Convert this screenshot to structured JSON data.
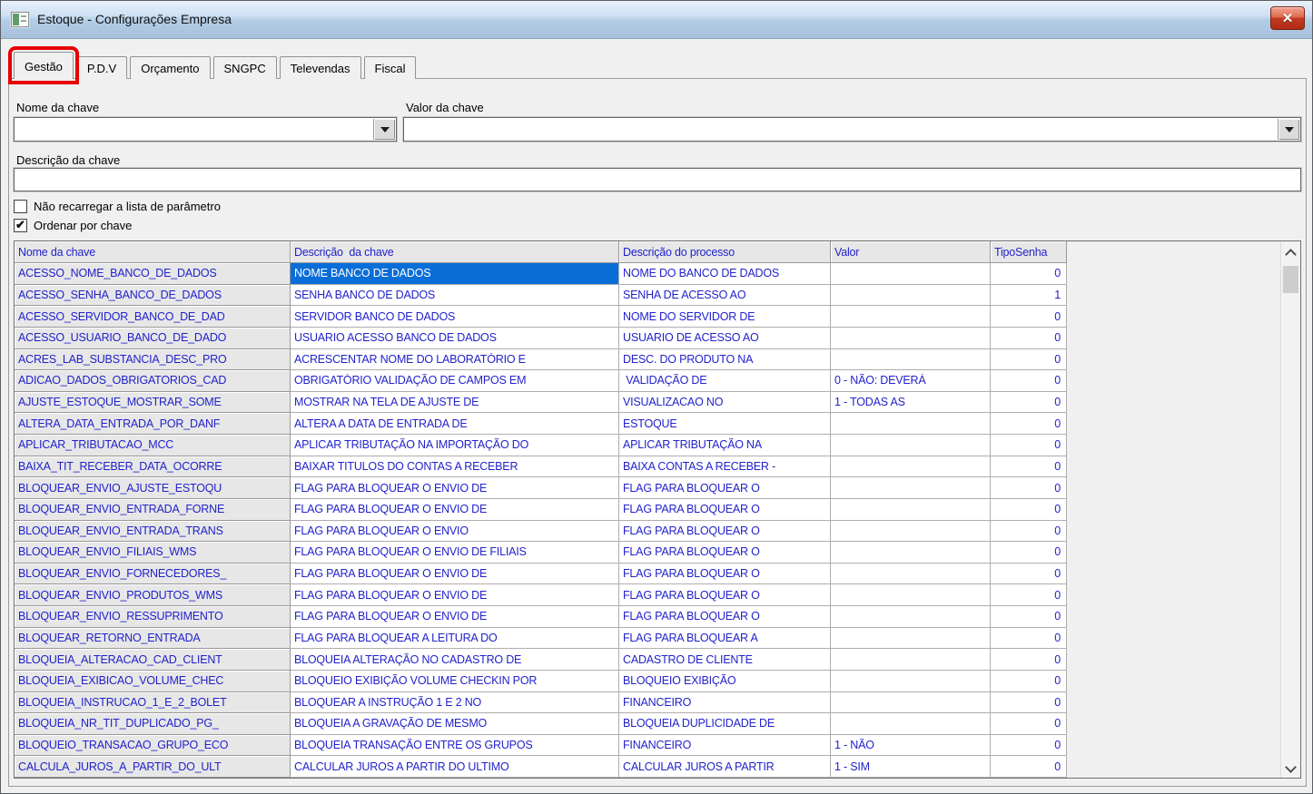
{
  "window": {
    "title": "Estoque - Configurações Empresa",
    "close_glyph": "✕"
  },
  "colors": {
    "grid_text_blue": "#2222cc",
    "selection_blue": "#0a6ed8",
    "annotation_red": "#e60000",
    "close_button_red": "#c23a22"
  },
  "tabs": [
    {
      "label": "Gestão",
      "active": true,
      "annotated": true
    },
    {
      "label": "P.D.V",
      "active": false,
      "annotated": false
    },
    {
      "label": "Orçamento",
      "active": false,
      "annotated": false
    },
    {
      "label": "SNGPC",
      "active": false,
      "annotated": false
    },
    {
      "label": "Televendas",
      "active": false,
      "annotated": false
    },
    {
      "label": "Fiscal",
      "active": false,
      "annotated": false
    }
  ],
  "form": {
    "nome_da_chave": {
      "label": "Nome da chave",
      "value": ""
    },
    "valor_da_chave": {
      "label": "Valor da chave",
      "value": ""
    },
    "descricao_da_chave": {
      "label": "Descrição da chave",
      "value": ""
    },
    "checkboxes": [
      {
        "label": "Não recarregar a lista de parâmetro",
        "checked": false
      },
      {
        "label": "Ordenar por chave",
        "checked": true
      }
    ]
  },
  "table": {
    "columns": [
      "Nome da chave",
      "Descrição  da chave",
      "Descrição do processo",
      "Valor",
      "TipoSenha"
    ],
    "selected_cell": {
      "row": 0,
      "col": 1
    },
    "rows": [
      [
        "ACESSO_NOME_BANCO_DE_DADOS",
        "NOME BANCO DE DADOS",
        "NOME DO BANCO DE DADOS",
        "",
        "0"
      ],
      [
        "ACESSO_SENHA_BANCO_DE_DADOS",
        "SENHA BANCO DE DADOS",
        "SENHA DE ACESSO AO",
        "",
        "1"
      ],
      [
        "ACESSO_SERVIDOR_BANCO_DE_DAD",
        "SERVIDOR BANCO DE DADOS",
        "NOME DO SERVIDOR DE",
        "",
        "0"
      ],
      [
        "ACESSO_USUARIO_BANCO_DE_DADO",
        "USUARIO ACESSO BANCO DE DADOS",
        "USUARIO DE ACESSO AO",
        "",
        "0"
      ],
      [
        "ACRES_LAB_SUBSTANCIA_DESC_PRO",
        "ACRESCENTAR NOME DO LABORATÓRIO E",
        "DESC. DO PRODUTO NA",
        "",
        "0"
      ],
      [
        "ADICAO_DADOS_OBRIGATORIOS_CAD",
        "OBRIGATÓRIO VALIDAÇÃO DE CAMPOS EM",
        " VALIDAÇÃO DE",
        "0 - NÃO: DEVERÁ",
        "0"
      ],
      [
        "AJUSTE_ESTOQUE_MOSTRAR_SOME",
        "MOSTRAR NA TELA DE AJUSTE DE",
        "VISUALIZACAO NO",
        "1 - TODAS AS",
        "0"
      ],
      [
        "ALTERA_DATA_ENTRADA_POR_DANF",
        "ALTERA A DATA DE ENTRADA DE",
        "ESTOQUE",
        "",
        "0"
      ],
      [
        "APLICAR_TRIBUTACAO_MCC",
        "APLICAR TRIBUTAÇÃO NA IMPORTAÇÃO DO",
        "APLICAR TRIBUTAÇÃO NA",
        "",
        "0"
      ],
      [
        "BAIXA_TIT_RECEBER_DATA_OCORRE",
        "BAIXAR TITULOS DO CONTAS A RECEBER",
        "BAIXA CONTAS A RECEBER -",
        "",
        "0"
      ],
      [
        "BLOQUEAR_ENVIO_AJUSTE_ESTOQU",
        "FLAG PARA BLOQUEAR O ENVIO DE",
        "FLAG PARA BLOQUEAR O",
        "",
        "0"
      ],
      [
        "BLOQUEAR_ENVIO_ENTRADA_FORNE",
        "FLAG PARA BLOQUEAR O ENVIO DE",
        "FLAG PARA BLOQUEAR O",
        "",
        "0"
      ],
      [
        "BLOQUEAR_ENVIO_ENTRADA_TRANS",
        "FLAG PARA BLOQUEAR O ENVIO",
        "FLAG PARA BLOQUEAR O",
        "",
        "0"
      ],
      [
        "BLOQUEAR_ENVIO_FILIAIS_WMS",
        "FLAG PARA BLOQUEAR O ENVIO DE FILIAIS",
        "FLAG PARA BLOQUEAR O",
        "",
        "0"
      ],
      [
        "BLOQUEAR_ENVIO_FORNECEDORES_",
        "FLAG PARA BLOQUEAR O ENVIO DE",
        "FLAG PARA BLOQUEAR O",
        "",
        "0"
      ],
      [
        "BLOQUEAR_ENVIO_PRODUTOS_WMS",
        "FLAG PARA BLOQUEAR O ENVIO DE",
        "FLAG PARA BLOQUEAR O",
        "",
        "0"
      ],
      [
        "BLOQUEAR_ENVIO_RESSUPRIMENTO",
        "FLAG PARA BLOQUEAR O ENVIO DE",
        "FLAG PARA BLOQUEAR O",
        "",
        "0"
      ],
      [
        "BLOQUEAR_RETORNO_ENTRADA",
        "FLAG PARA BLOQUEAR A LEITURA DO",
        "FLAG PARA BLOQUEAR A",
        "",
        "0"
      ],
      [
        "BLOQUEIA_ALTERACAO_CAD_CLIENT",
        "BLOQUEIA ALTERAÇÃO NO CADASTRO DE",
        "CADASTRO DE CLIENTE",
        "",
        "0"
      ],
      [
        "BLOQUEIA_EXIBICAO_VOLUME_CHEC",
        "BLOQUEIO EXIBIÇÃO VOLUME CHECKIN POR",
        "BLOQUEIO EXIBIÇÃO",
        "",
        "0"
      ],
      [
        "BLOQUEIA_INSTRUCAO_1_E_2_BOLET",
        "BLOQUEAR A INSTRUÇÃO 1 E 2 NO",
        "FINANCEIRO",
        "",
        "0"
      ],
      [
        "BLOQUEIA_NR_TIT_DUPLICADO_PG_",
        "BLOQUEIA A GRAVAÇÃO DE MESMO",
        "BLOQUEIA DUPLICIDADE DE",
        "",
        "0"
      ],
      [
        "BLOQUEIO_TRANSACAO_GRUPO_ECO",
        "BLOQUEIA TRANSAÇÃO ENTRE OS GRUPOS",
        "FINANCEIRO",
        "1 - NÃO",
        "0"
      ],
      [
        "CALCULA_JUROS_A_PARTIR_DO_ULT",
        "CALCULAR JUROS A PARTIR DO ULTIMO",
        "CALCULAR JUROS A PARTIR",
        "1 - SIM",
        "0"
      ]
    ]
  },
  "annotation": {
    "shape": "rectangle",
    "color": "#e60000",
    "target": "tab-gestao"
  }
}
